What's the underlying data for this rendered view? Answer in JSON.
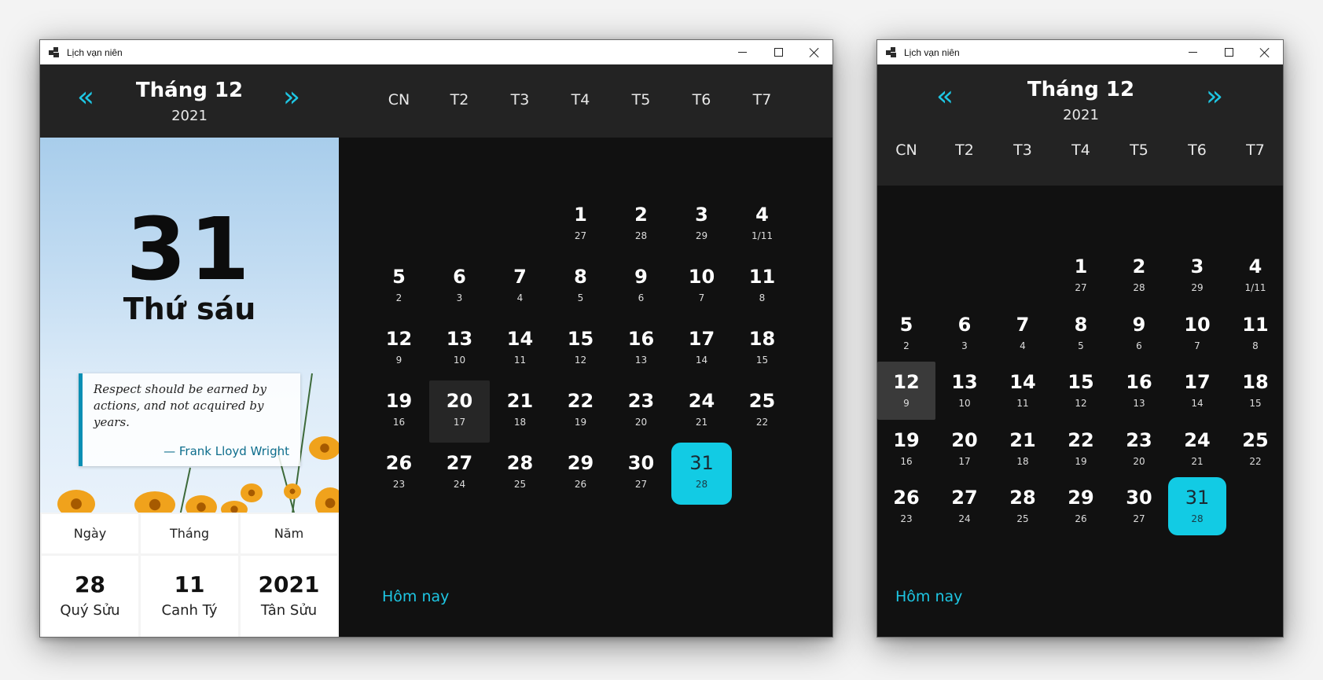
{
  "app": {
    "title": "Lịch vạn niên"
  },
  "calendar": {
    "month_label": "Tháng 12",
    "year_label": "2021",
    "prev_icon": "«",
    "next_icon": "»",
    "weekdays": [
      "CN",
      "T2",
      "T3",
      "T4",
      "T5",
      "T6",
      "T7"
    ],
    "start_weekday_index": 3,
    "days": [
      {
        "d": "1",
        "l": "27"
      },
      {
        "d": "2",
        "l": "28"
      },
      {
        "d": "3",
        "l": "29"
      },
      {
        "d": "4",
        "l": "1/11"
      },
      {
        "d": "5",
        "l": "2"
      },
      {
        "d": "6",
        "l": "3"
      },
      {
        "d": "7",
        "l": "4"
      },
      {
        "d": "8",
        "l": "5"
      },
      {
        "d": "9",
        "l": "6"
      },
      {
        "d": "10",
        "l": "7"
      },
      {
        "d": "11",
        "l": "8"
      },
      {
        "d": "12",
        "l": "9"
      },
      {
        "d": "13",
        "l": "10"
      },
      {
        "d": "14",
        "l": "11"
      },
      {
        "d": "15",
        "l": "12"
      },
      {
        "d": "16",
        "l": "13"
      },
      {
        "d": "17",
        "l": "14"
      },
      {
        "d": "18",
        "l": "15"
      },
      {
        "d": "19",
        "l": "16"
      },
      {
        "d": "20",
        "l": "17"
      },
      {
        "d": "21",
        "l": "18"
      },
      {
        "d": "22",
        "l": "19"
      },
      {
        "d": "23",
        "l": "20"
      },
      {
        "d": "24",
        "l": "21"
      },
      {
        "d": "25",
        "l": "22"
      },
      {
        "d": "26",
        "l": "23"
      },
      {
        "d": "27",
        "l": "24"
      },
      {
        "d": "28",
        "l": "25"
      },
      {
        "d": "29",
        "l": "26"
      },
      {
        "d": "30",
        "l": "27"
      },
      {
        "d": "31",
        "l": "28"
      }
    ],
    "selected_day": "31",
    "hover_day_large_window": "20",
    "hover_day_small_window": "12",
    "today_link": "Hôm nay"
  },
  "detail": {
    "big_day": "31",
    "weekday": "Thứ sáu",
    "quote": {
      "text": "Respect should be earned by actions, and not acquired by years.",
      "author": "— Frank Lloyd Wright"
    },
    "lunar": {
      "headers": [
        "Ngày",
        "Tháng",
        "Năm"
      ],
      "values": [
        {
          "num": "28",
          "name": "Quý Sửu"
        },
        {
          "num": "11",
          "name": "Canh Tý"
        },
        {
          "num": "2021",
          "name": "Tân Sửu"
        }
      ]
    }
  },
  "colors": {
    "accent": "#12cbe4",
    "header_bg": "#232323",
    "body_bg": "#111111",
    "quote_border": "#0a8fb4"
  }
}
